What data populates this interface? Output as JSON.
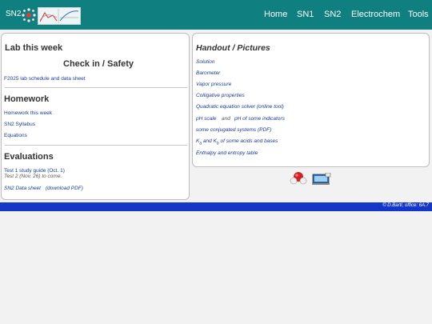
{
  "header": {
    "brand": "SN2",
    "nav": [
      "Home",
      "SN1",
      "SN2",
      "Electrochem",
      "Tools"
    ]
  },
  "left": {
    "lab_title": "Lab this week",
    "checkin": "Check in / Safety",
    "lab_link": "F2025 lab schedule and data sheet",
    "homework_title": "Homework",
    "homework_links": [
      "Homework this week",
      "SN2 Syllabus",
      "Equations"
    ],
    "evaluations_title": "Evaluations",
    "test1": "Test 1 study guide (Oct. 1)",
    "test2": "Test 2 (Nov. 26) to come.",
    "datasheet": "SN2 Data sheet",
    "download": "(download PDF)"
  },
  "right": {
    "title": "Handout / Pictures",
    "links": [
      "Solution",
      "Barometer",
      "Vapor pressure",
      "Colligative properties",
      "Quadratic equation solver (online tool)"
    ],
    "ph_scale": "pH scale",
    "and": "and",
    "ph_indicators": "pH of some indicators",
    "conjugated": "some conjugated systems (PDF)",
    "ka_k": "K",
    "ka_a": "a",
    "ka_and": " and K",
    "ka_b": "b",
    "ka_rest": " of some acids and bases",
    "enthalpy": "Enthalpy and entropy table"
  },
  "footer": {
    "credit": "© D.Bartl, office: 6A.7"
  },
  "colors": {
    "header_bg": "#0f7f7f",
    "link": "#1a3a9e",
    "footer_bg": "#1537c8"
  },
  "icons": [
    "atom-logo-icon",
    "chart-logo-icon",
    "molecule-icon",
    "computer-icon"
  ]
}
